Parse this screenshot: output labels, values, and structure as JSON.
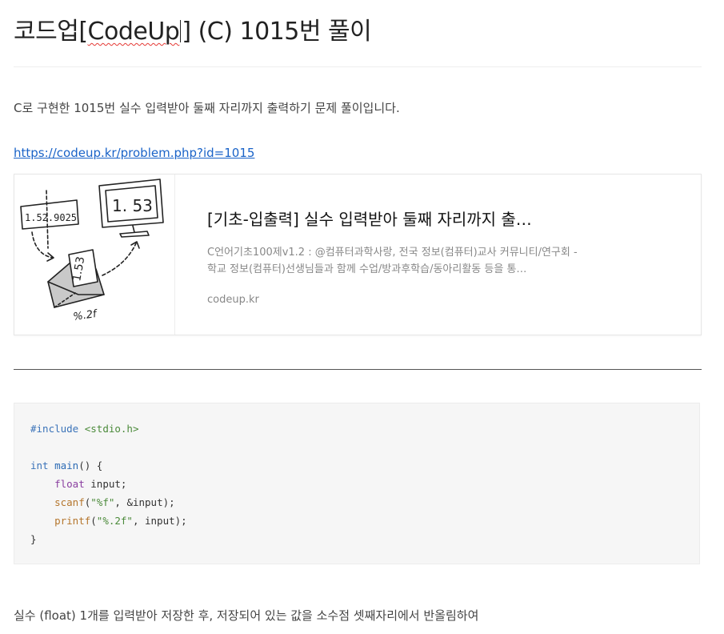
{
  "post": {
    "title_prefix": "코드업",
    "title_bracket_open": "[",
    "title_bracket_text": "CodeUp",
    "title_bracket_close": "]",
    "title_rest": " (C) 1015번 풀이",
    "intro": "C로 구현한 1015번 실수 입력받아 둘째 자리까지 출력하기 문제 풀이입니다.",
    "link": "https://codeup.kr/problem.php?id=1015",
    "outro": "실수 (float) 1개를 입력받아 저장한 후, 저장되어 있는 값을 소수점 셋째자리에서 반올림하여"
  },
  "card": {
    "title": "[기초-입출력] 실수 입력받아 둘째 자리까지 출…",
    "description": "C언어기초100제v1.2 : @컴퓨터과학사랑, 전국 정보(컴퓨터)교사 커뮤니티/연구회 - 학교 정보(컴퓨터)선생님들과 함께 수업/방과후학습/동아리활동 등을 통…",
    "domain": "codeup.kr",
    "thumb": {
      "input_value": "1.52.9025",
      "monitor_value": "1. 53",
      "envelope_value": "1.53",
      "format_text": "%.2f"
    }
  },
  "code": {
    "include_kw": "#include",
    "include_file": "<stdio.h>",
    "int_kw": "int",
    "main_fn": "main",
    "main_rest": "() {",
    "float_kw": "float",
    "float_rest": " input;",
    "scanf_fn": "scanf",
    "scanf_open": "(",
    "scanf_fmt": "\"%f\"",
    "scanf_rest": ", &input);",
    "printf_fn": "printf",
    "printf_open": "(",
    "printf_fmt": "\"%.2f\"",
    "printf_rest": ", input);",
    "close": "}"
  },
  "colors": {
    "link": "#1a63c8",
    "code_bg": "#f6f6f6"
  }
}
